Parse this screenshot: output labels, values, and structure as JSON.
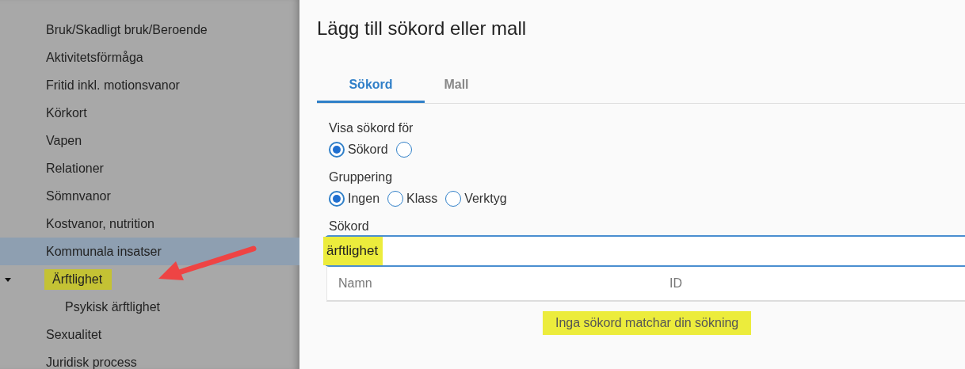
{
  "sidebar": {
    "items": [
      {
        "label": "Bruk/Skadligt bruk/Beroende",
        "selected": false,
        "highlighted": false
      },
      {
        "label": "Aktivitetsförmåga",
        "selected": false,
        "highlighted": false
      },
      {
        "label": "Fritid inkl. motionsvanor",
        "selected": false,
        "highlighted": false
      },
      {
        "label": "Körkort",
        "selected": false,
        "highlighted": false
      },
      {
        "label": "Vapen",
        "selected": false,
        "highlighted": false
      },
      {
        "label": "Relationer",
        "selected": false,
        "highlighted": false
      },
      {
        "label": "Sömnvanor",
        "selected": false,
        "highlighted": false
      },
      {
        "label": "Kostvanor, nutrition",
        "selected": false,
        "highlighted": false
      },
      {
        "label": "Kommunala insatser",
        "selected": true,
        "highlighted": false
      },
      {
        "label": "Ärftlighet",
        "selected": false,
        "highlighted": true,
        "expanded": true,
        "children": [
          {
            "label": "Psykisk ärftlighet",
            "selected": false,
            "highlighted": false
          }
        ]
      },
      {
        "label": "Sexualitet",
        "selected": false,
        "highlighted": false
      },
      {
        "label": "Juridisk process",
        "selected": false,
        "highlighted": false
      }
    ]
  },
  "dialog": {
    "title": "Lägg till sökord eller mall",
    "tabs": [
      {
        "label": "Sökord",
        "selected": true
      },
      {
        "label": "Mall",
        "selected": false
      }
    ],
    "radio_groups": [
      {
        "label": "Visa sökord för",
        "options": [
          {
            "label": "Sökord",
            "selected": true
          },
          {
            "selected": false
          }
        ]
      },
      {
        "label": "Gruppering",
        "options": [
          {
            "label": "Ingen",
            "selected": true
          },
          {
            "label": "Klass",
            "selected": false
          },
          {
            "label": "Verktyg",
            "selected": false
          }
        ]
      }
    ],
    "search": {
      "label": "Sökord",
      "value": "ärftlighet",
      "highlighted": true
    },
    "table": {
      "columns": [
        "Namn",
        "ID"
      ]
    },
    "empty_message": {
      "text": "Inga sökord matchar din sökning",
      "highlighted": true
    }
  }
}
